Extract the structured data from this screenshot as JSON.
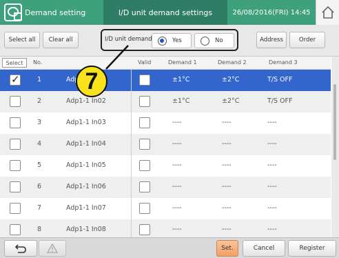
{
  "header": {
    "app_title": "Demand setting",
    "screen_title": "I/D unit demand settings",
    "datetime": "26/08/2016(FRI) 14:45"
  },
  "toolbar": {
    "select_all": "Select all",
    "clear_all": "Clear all",
    "idu_demand_label": "I/D unit demand",
    "yes_label": "Yes",
    "no_label": "No",
    "selected_option": "Yes",
    "address_label": "Address",
    "order_label": "Order"
  },
  "columns": {
    "select": "Select",
    "no": "No.",
    "valid": "Valid",
    "demand1": "Demand 1",
    "demand2": "Demand 2",
    "demand3": "Demand 3"
  },
  "rows": [
    {
      "no": "1",
      "name": "Adp1-1 In01",
      "selected": true,
      "valid": false,
      "d1": "±1°C",
      "d2": "±2°C",
      "d3": "T/S OFF"
    },
    {
      "no": "2",
      "name": "Adp1-1 In02",
      "selected": false,
      "valid": false,
      "d1": "±1°C",
      "d2": "±2°C",
      "d3": "T/S OFF"
    },
    {
      "no": "3",
      "name": "Adp1-1 In03",
      "selected": false,
      "valid": false,
      "d1": "----",
      "d2": "----",
      "d3": "----"
    },
    {
      "no": "4",
      "name": "Adp1-1 In04",
      "selected": false,
      "valid": false,
      "d1": "----",
      "d2": "----",
      "d3": "----"
    },
    {
      "no": "5",
      "name": "Adp1-1 In05",
      "selected": false,
      "valid": false,
      "d1": "----",
      "d2": "----",
      "d3": "----"
    },
    {
      "no": "6",
      "name": "Adp1-1 In06",
      "selected": false,
      "valid": false,
      "d1": "----",
      "d2": "----",
      "d3": "----"
    },
    {
      "no": "7",
      "name": "Adp1-1 In07",
      "selected": false,
      "valid": false,
      "d1": "----",
      "d2": "----",
      "d3": "----"
    },
    {
      "no": "8",
      "name": "Adp1-1 In08",
      "selected": false,
      "valid": false,
      "d1": "----",
      "d2": "----",
      "d3": "----"
    }
  ],
  "callout": {
    "number": "7"
  },
  "footer": {
    "set_label": "Set.",
    "cancel_label": "Cancel",
    "register_label": "Register"
  },
  "icons": {
    "app": "demand-setting-icon",
    "home": "home-icon",
    "back": "back-arrow-icon",
    "warning": "warning-icon"
  },
  "colors": {
    "header_green": "#3fa07d",
    "header_dark_green": "#2f7d64",
    "selected_row": "#3366cc",
    "set_button": "#f2a064",
    "callout": "#f8e21b"
  }
}
